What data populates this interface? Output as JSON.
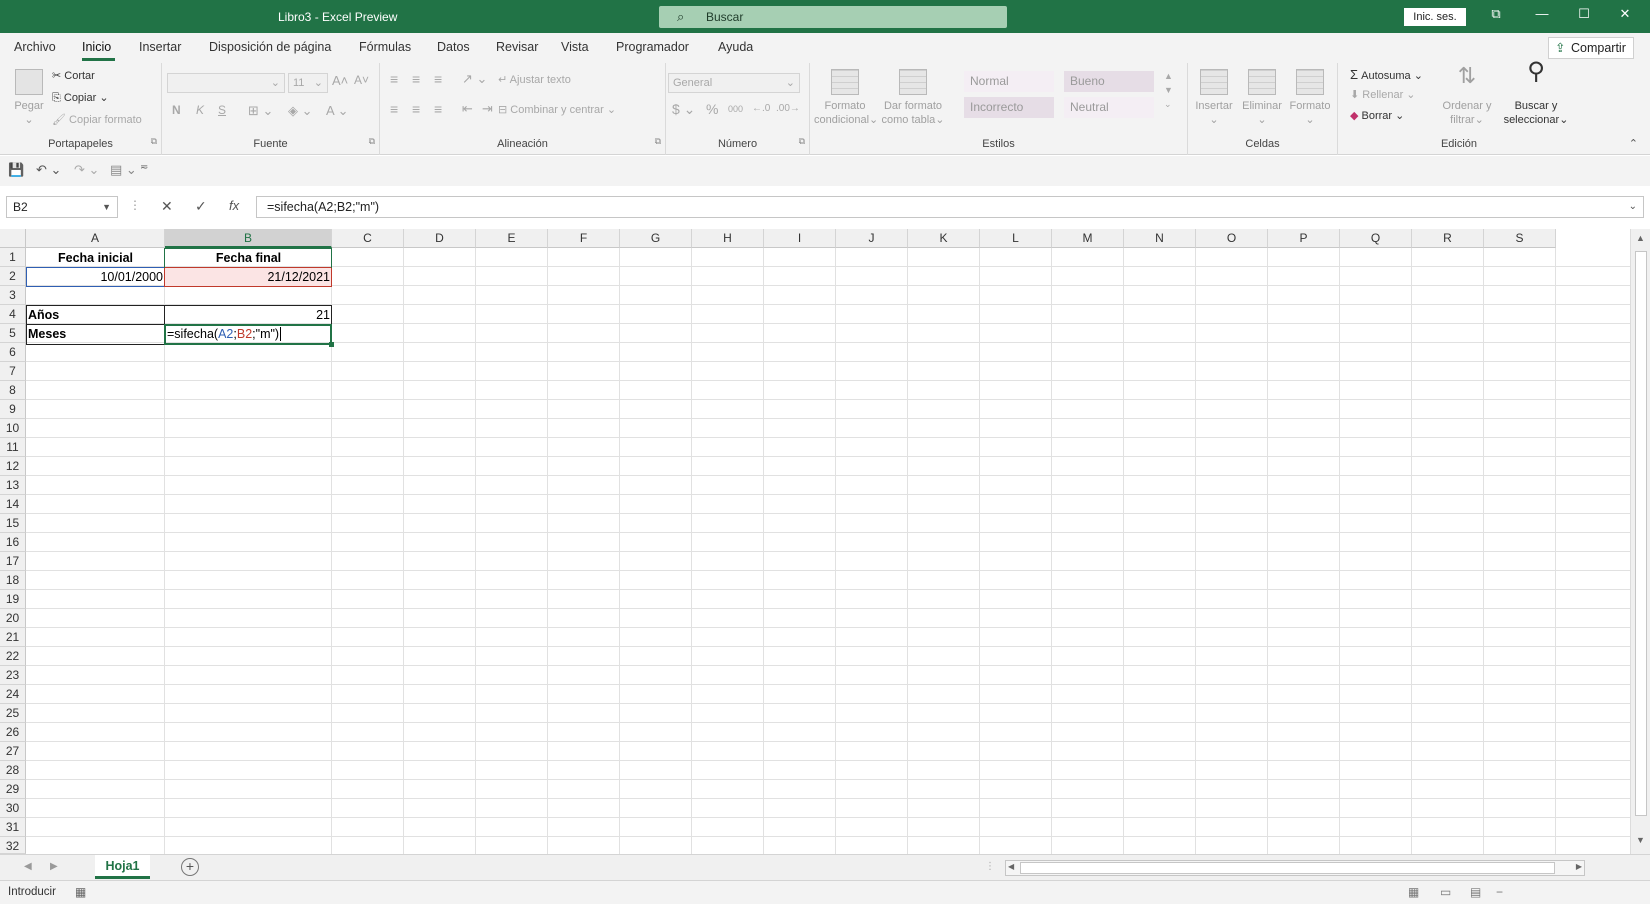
{
  "window": {
    "title": "Libro3  -  Excel Preview",
    "search_placeholder": "Buscar",
    "sign_in": "Inic. ses."
  },
  "menu": {
    "tabs": [
      "Archivo",
      "Inicio",
      "Insertar",
      "Disposición de página",
      "Fórmulas",
      "Datos",
      "Revisar",
      "Vista",
      "Programador",
      "Ayuda"
    ],
    "active_tab": "Inicio",
    "share": "Compartir"
  },
  "ribbon": {
    "portapapeles": {
      "label": "Portapapeles",
      "paste": "Pegar",
      "cut": "Cortar",
      "copy": "Copiar",
      "format_painter": "Copiar formato"
    },
    "fuente": {
      "label": "Fuente",
      "size": "11",
      "bold": "N",
      "italic": "K",
      "underline": "S"
    },
    "alineacion": {
      "label": "Alineación",
      "wrap": "Ajustar texto",
      "merge": "Combinar y centrar"
    },
    "numero": {
      "label": "Número",
      "format": "General",
      "currency": "$",
      "percent": "%",
      "thousands": "000"
    },
    "estilos": {
      "label": "Estilos",
      "conditional": [
        "Formato",
        "condicional"
      ],
      "as_table": [
        "Dar formato",
        "como tabla"
      ],
      "cells": [
        "Normal",
        "Bueno",
        "Incorrecto",
        "Neutral"
      ]
    },
    "celdas": {
      "label": "Celdas",
      "insert": "Insertar",
      "delete": "Eliminar",
      "format": "Formato"
    },
    "edicion": {
      "label": "Edición",
      "autosum": "Autosuma",
      "fill": "Rellenar",
      "clear": "Borrar",
      "sort": [
        "Ordenar y",
        "filtrar"
      ],
      "find": [
        "Buscar y",
        "seleccionar"
      ]
    }
  },
  "formula_bar": {
    "name_box": "B2",
    "formula": "=sifecha(A2;B2;\"m\")"
  },
  "grid": {
    "columns": [
      "A",
      "B",
      "C",
      "D",
      "E",
      "F",
      "G",
      "H",
      "I",
      "J",
      "K",
      "L",
      "M",
      "N",
      "O",
      "P",
      "Q",
      "R",
      "S"
    ],
    "rows": [
      "1",
      "2",
      "3",
      "4",
      "5",
      "6",
      "7",
      "8",
      "9",
      "10",
      "11",
      "12",
      "13",
      "14",
      "15",
      "16",
      "17",
      "18",
      "19",
      "20",
      "21",
      "22",
      "23",
      "24",
      "25",
      "26",
      "27",
      "28",
      "29",
      "30",
      "31",
      "32"
    ],
    "cells": {
      "A1": "Fecha inicial",
      "B1": "Fecha final",
      "A2": "10/01/2000",
      "B2": "21/12/2021",
      "A4": "Años",
      "B4": "21",
      "A5": "Meses",
      "B5": {
        "p1": "=sifecha(",
        "ref1": "A2",
        "sep1": ";",
        "ref2": "B2",
        "rest": ";\"m\")"
      }
    }
  },
  "sheets": {
    "active": "Hoja1"
  },
  "status": {
    "mode": "Introducir"
  },
  "colors": {
    "accent": "#217346",
    "ref_blue": "#2f5fb3",
    "ref_red": "#c0392b"
  }
}
